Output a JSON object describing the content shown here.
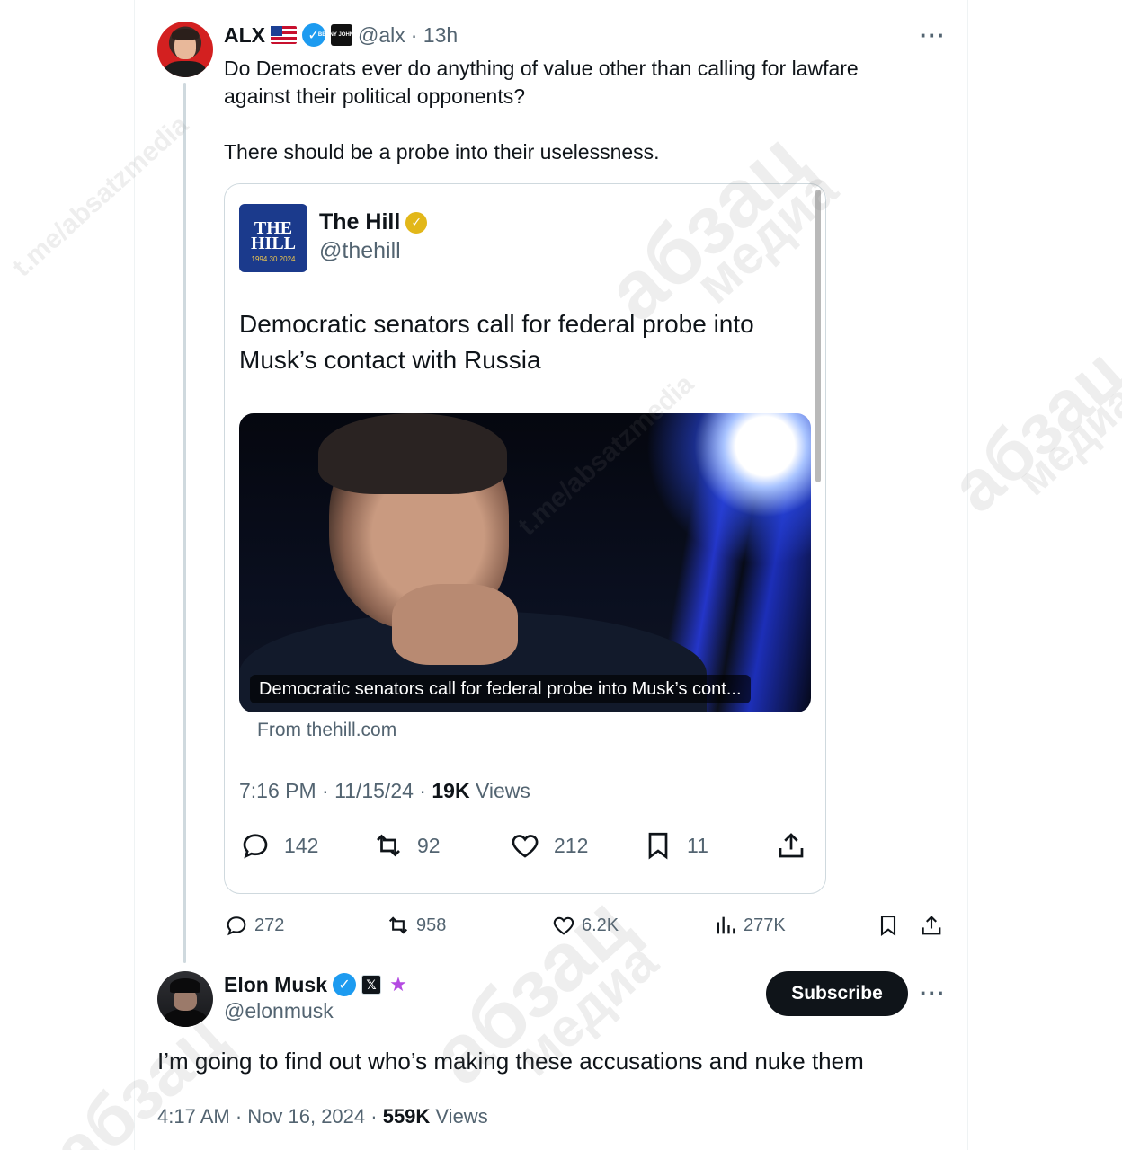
{
  "alx_tweet": {
    "name": "ALX",
    "handle": "@alx",
    "time": "· 13h",
    "text_line1": "Do Democrats ever do anything of value other than calling for lawfare against their political opponents?",
    "text_line2": "There should be a probe into their uselessness.",
    "badge_label": "BENNY JOHNSON",
    "stats": {
      "replies": "272",
      "reposts": "958",
      "likes": "6.2K",
      "views": "277K"
    }
  },
  "quoted_tweet": {
    "name": "The Hill",
    "handle": "@thehill",
    "logo_line1": "THE",
    "logo_line2": "HILL",
    "logo_line3": "1994 30 2024",
    "headline": "Democratic senators call for federal probe into Musk’s contact with Russia",
    "image_caption": "Democratic senators call for federal probe into Musk’s cont...",
    "source": "From thehill.com",
    "time": "7:16 PM · 11/15/24 · ",
    "views_count": "19K",
    "views_label": " Views",
    "stats": {
      "replies": "142",
      "reposts": "92",
      "likes": "212",
      "bookmarks": "11"
    }
  },
  "elon_tweet": {
    "name": "Elon Musk",
    "handle": "@elonmusk",
    "subscribe_label": "Subscribe",
    "text": "I’m going to find out who’s making these accusations and nuke them",
    "time": "4:17 AM · Nov 16, 2024 · ",
    "views_count": "559K",
    "views_label": " Views"
  },
  "watermark": {
    "channel": "t.me/absatzmedia",
    "brand": "абзац",
    "brand_sub": "медиа"
  },
  "icons": {
    "more": "more-icon",
    "reply": "reply-icon",
    "repost": "repost-icon",
    "like": "heart-icon",
    "views": "views-icon",
    "bookmark": "bookmark-icon",
    "share": "share-icon",
    "verified": "verified-badge-icon"
  },
  "colors": {
    "text_primary": "#0f1419",
    "text_secondary": "#536471",
    "verified_blue": "#1d9bf0",
    "verified_gold": "#e2b719",
    "hill_blue": "#1b3a8c"
  }
}
